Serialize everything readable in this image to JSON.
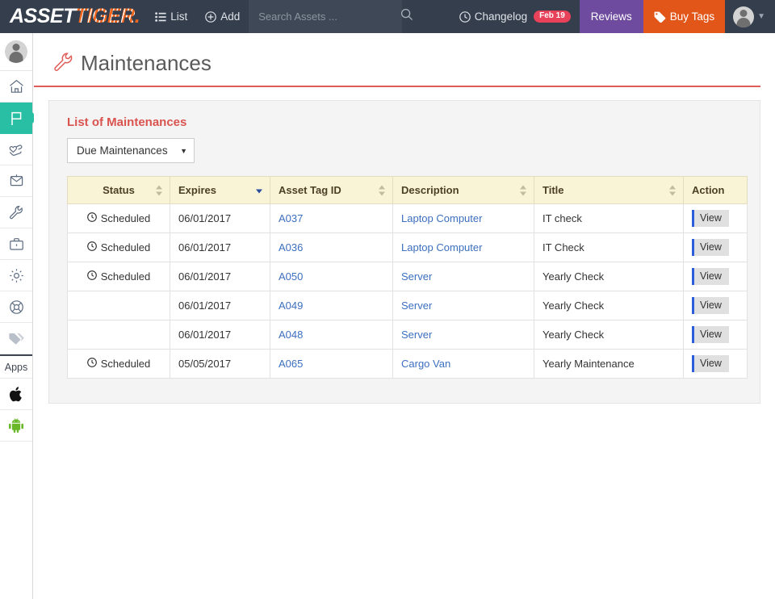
{
  "topnav": {
    "logo_asset": "ASSET",
    "logo_tiger": "TIGER",
    "list_label": "List",
    "add_label": "Add",
    "search_placeholder": "Search Assets ...",
    "search_value": "",
    "changelog_label": "Changelog",
    "changelog_badge": "Feb 19",
    "reviews_label": "Reviews",
    "buytags_label": "Buy Tags",
    "colors": {
      "navbar_bg": "#343e4d",
      "search_bg": "#3e4857",
      "badge": "#e8415a",
      "reviews_bg": "#6e4b9e",
      "buytags_bg": "#e2561a",
      "logo_orange": "#f0661e"
    }
  },
  "sidebar": {
    "items": [
      {
        "icon": "avatar-icon",
        "name": "profile"
      },
      {
        "icon": "home-icon",
        "name": "dashboard"
      },
      {
        "icon": "flag-icon",
        "name": "flag",
        "active": true
      },
      {
        "icon": "hand-heart-icon",
        "name": "donations"
      },
      {
        "icon": "mailbox-icon",
        "name": "mailbox"
      },
      {
        "icon": "wrench-icon",
        "name": "maintenance"
      },
      {
        "icon": "briefcase-icon",
        "name": "briefcase"
      },
      {
        "icon": "gear-icon",
        "name": "settings"
      },
      {
        "icon": "globe-icon",
        "name": "globe"
      },
      {
        "icon": "tags-icon",
        "name": "tags"
      }
    ],
    "apps_label": "Apps",
    "apps": [
      {
        "icon": "apple-icon",
        "name": "apple-app"
      },
      {
        "icon": "android-icon",
        "name": "android-app"
      }
    ],
    "active_color": "#29bfa4"
  },
  "page": {
    "title": "Maintenances",
    "title_icon": "wrench-icon",
    "accent_color": "#e05c58"
  },
  "panel": {
    "heading": "List of Maintenances",
    "filter_selected": "Due Maintenances",
    "filter_options": [
      "Due Maintenances"
    ]
  },
  "table": {
    "columns": [
      {
        "label": "Status",
        "sort": "none"
      },
      {
        "label": "Expires",
        "sort": "desc"
      },
      {
        "label": "Asset Tag ID",
        "sort": "none"
      },
      {
        "label": "Description",
        "sort": "none"
      },
      {
        "label": "Title",
        "sort": "none"
      },
      {
        "label": "Action",
        "sort": null
      }
    ],
    "action_label": "View",
    "rows": [
      {
        "status": "Scheduled",
        "expires": "06/01/2017",
        "tag": "A037",
        "description": "Laptop Computer",
        "title": "IT check",
        "action": "View"
      },
      {
        "status": "Scheduled",
        "expires": "06/01/2017",
        "tag": "A036",
        "description": "Laptop Computer",
        "title": "IT Check",
        "action": "View"
      },
      {
        "status": "Scheduled",
        "expires": "06/01/2017",
        "tag": "A050",
        "description": "Server",
        "title": "Yearly Check",
        "action": "View"
      },
      {
        "status": "",
        "expires": "06/01/2017",
        "tag": "A049",
        "description": "Server",
        "title": "Yearly Check",
        "action": "View"
      },
      {
        "status": "",
        "expires": "06/01/2017",
        "tag": "A048",
        "description": "Server",
        "title": "Yearly Check",
        "action": "View"
      },
      {
        "status": "Scheduled",
        "expires": "05/05/2017",
        "tag": "A065",
        "description": "Cargo Van",
        "title": "Yearly Maintenance",
        "action": "View"
      }
    ]
  }
}
